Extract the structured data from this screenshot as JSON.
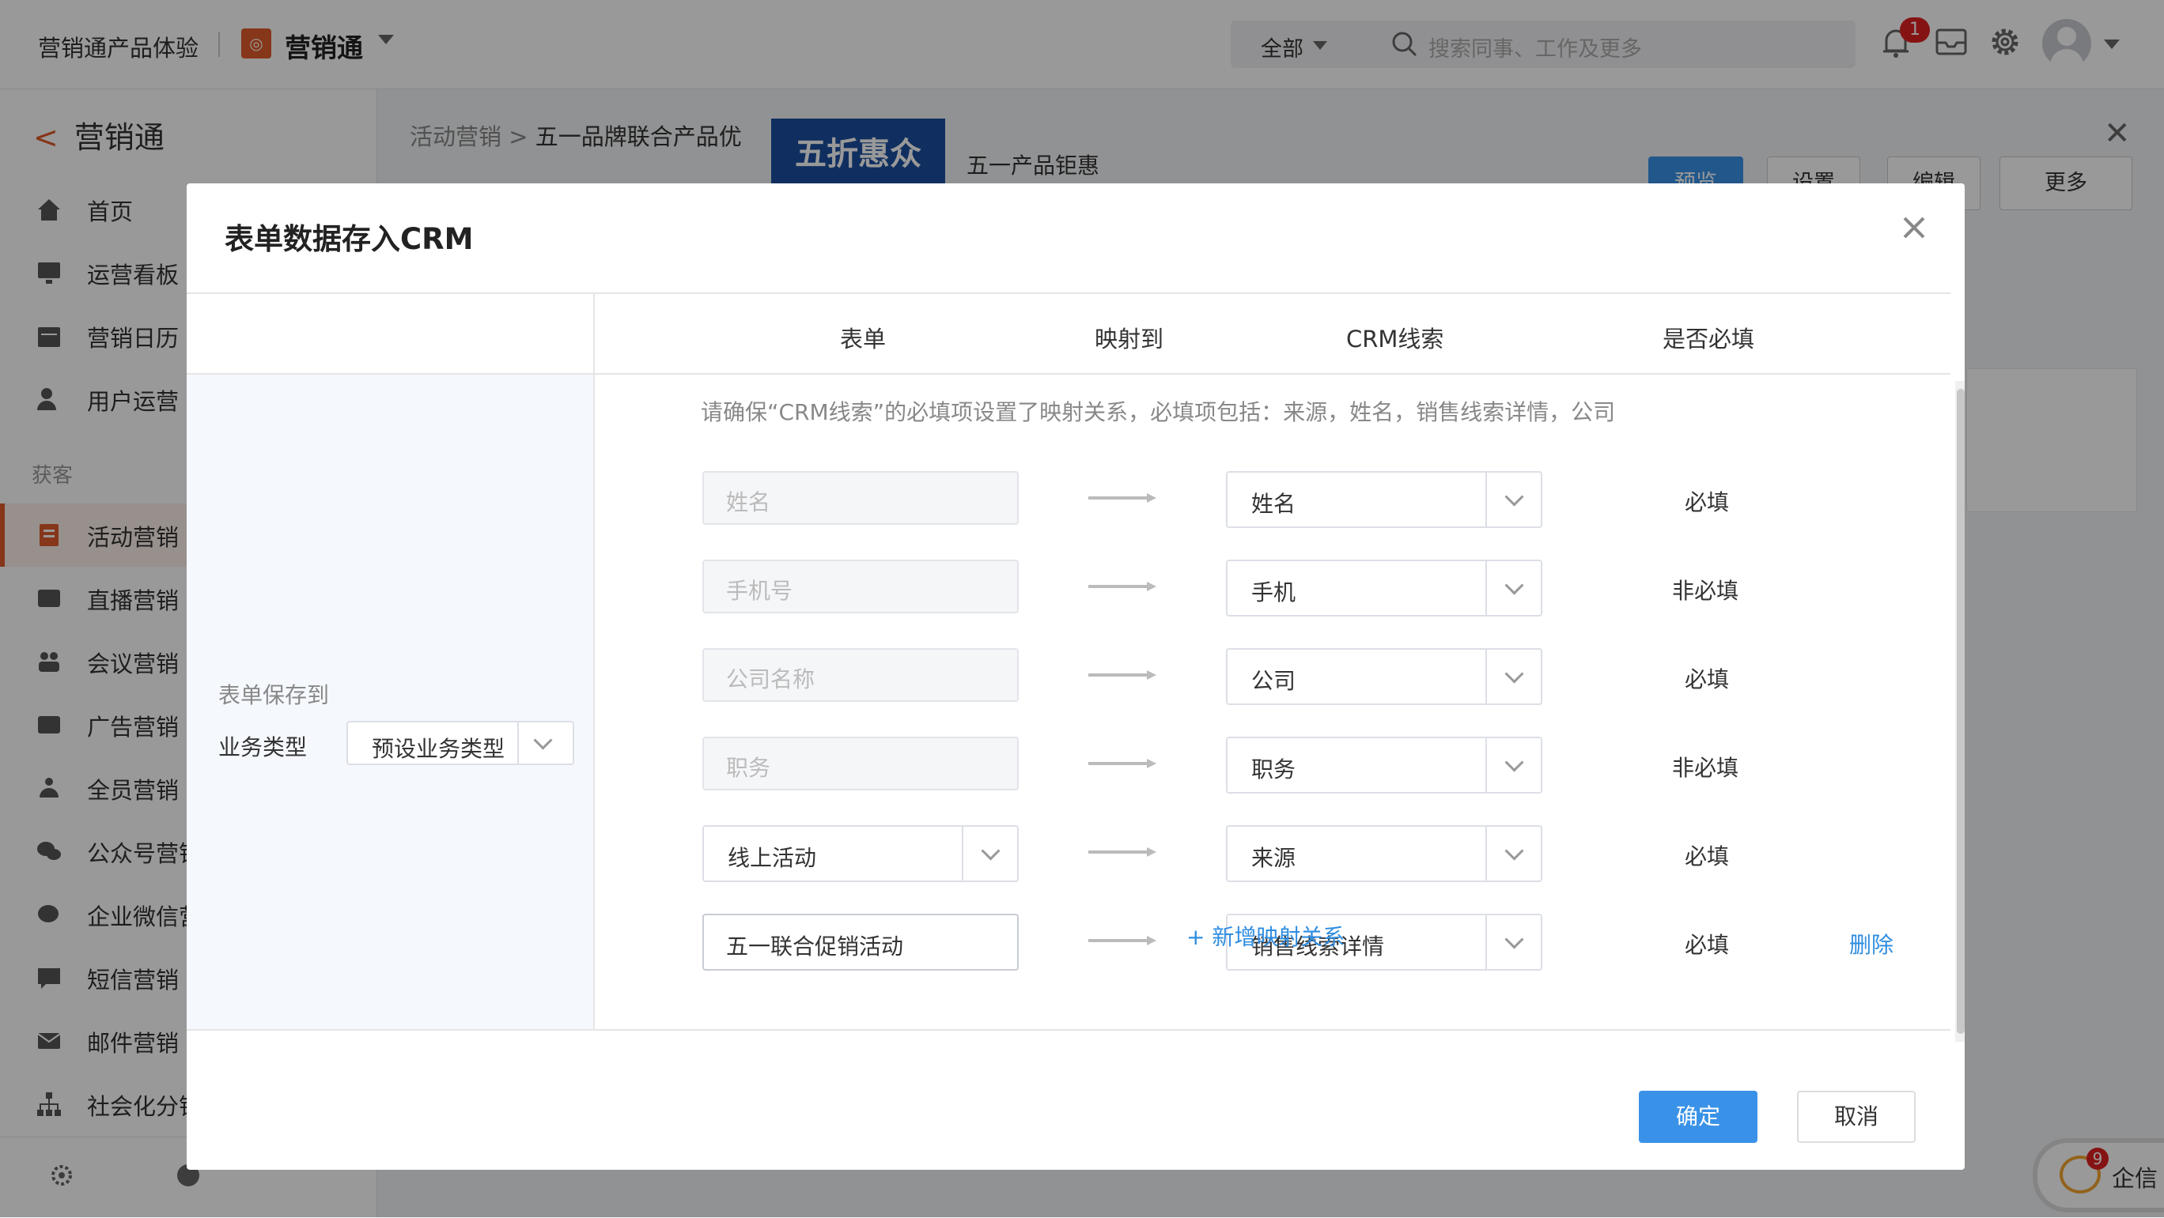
{
  "topbar": {
    "app_name": "营销通产品体验",
    "product_name": "营销通",
    "search_scope": "全部",
    "search_placeholder": "搜索同事、工作及更多",
    "notification_count": "1"
  },
  "sidebar": {
    "back_label": "营销通",
    "group_label": "获客",
    "items": [
      {
        "label": "首页"
      },
      {
        "label": "运营看板"
      },
      {
        "label": "营销日历"
      },
      {
        "label": "用户运营"
      },
      {
        "label": "活动营销"
      },
      {
        "label": "直播营销"
      },
      {
        "label": "会议营销"
      },
      {
        "label": "广告营销"
      },
      {
        "label": "全员营销"
      },
      {
        "label": "公众号营销"
      },
      {
        "label": "企业微信营销"
      },
      {
        "label": "短信营销"
      },
      {
        "label": "邮件营销"
      },
      {
        "label": "社会化分销"
      }
    ]
  },
  "background": {
    "breadcrumb_root": "活动营销",
    "breadcrumb_current": "五一品牌联合产品优",
    "card_image_text": "五折惠众",
    "card_title": "五一产品钜惠",
    "buttons": [
      "预览",
      "设置",
      "编辑",
      "更多"
    ]
  },
  "qixin": {
    "label": "企信",
    "count": "9"
  },
  "modal": {
    "title": "表单数据存入CRM",
    "left": {
      "save_to_label": "表单保存到",
      "business_type_label": "业务类型",
      "business_type_value": "预设业务类型"
    },
    "columns": [
      "表单",
      "映射到",
      "CRM线索",
      "是否必填"
    ],
    "notice": "请确保“CRM线索”的必填项设置了映射关系，必填项包括：来源，姓名，销售线索详情，公司",
    "rows": [
      {
        "form_field": "姓名",
        "crm_field": "姓名",
        "required": "必填"
      },
      {
        "form_field": "手机号",
        "crm_field": "手机",
        "required": "非必填"
      },
      {
        "form_field": "公司名称",
        "crm_field": "公司",
        "required": "必填"
      },
      {
        "form_field": "职务",
        "crm_field": "职务",
        "required": "非必填"
      },
      {
        "form_field": "线上活动",
        "crm_field": "来源",
        "required": "必填"
      },
      {
        "form_field": "五一联合促销活动",
        "crm_field": "销售线索详情",
        "required": "必填",
        "action": "删除"
      }
    ],
    "add_mapping": "+ 新增映射关系",
    "ok_label": "确定",
    "cancel_label": "取消"
  },
  "colors": {
    "accent": "#3a92e8",
    "brand": "#e05a2b",
    "link": "#2f8de0"
  }
}
